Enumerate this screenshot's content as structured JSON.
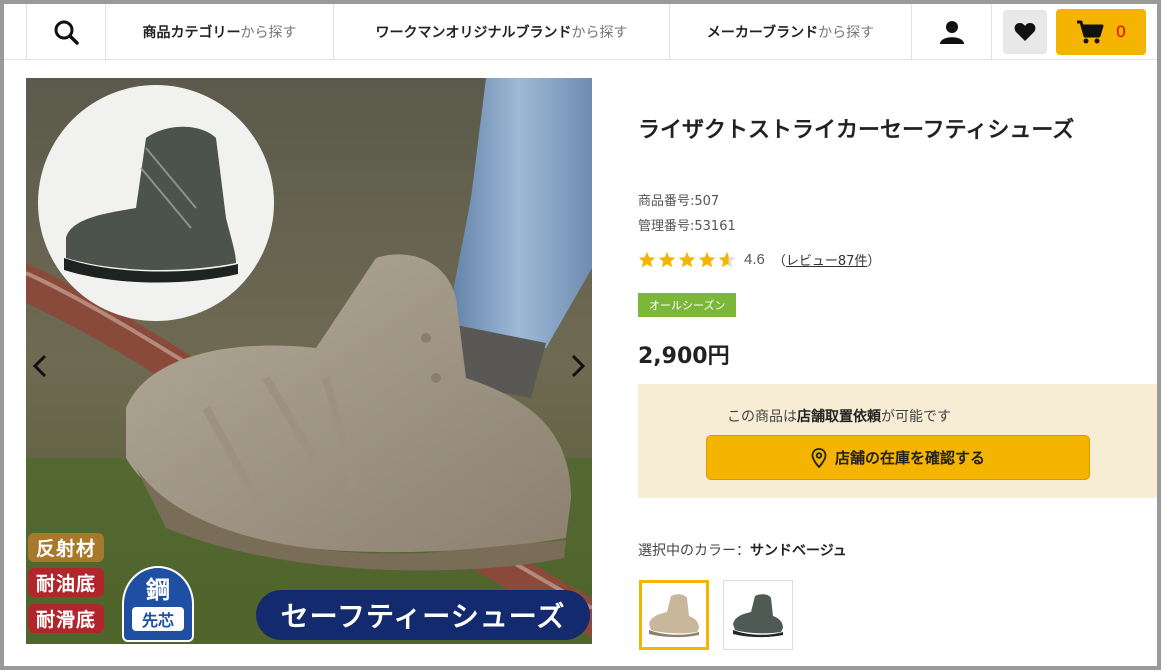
{
  "header": {
    "nav": [
      {
        "bold": "商品カテゴリー",
        "suffix": "から探す"
      },
      {
        "bold": "ワークマンオリジナルブランド",
        "suffix": "から探す"
      },
      {
        "bold": "メーカーブランド",
        "suffix": "から探す"
      }
    ],
    "cart_count": "0",
    "accent_color": "#f5b400"
  },
  "gallery": {
    "badges": [
      "反射材",
      "耐油底",
      "耐滑底"
    ],
    "steel_badge": {
      "top": "鋼",
      "bottom": "先芯"
    },
    "banner": "セーフティーシューズ"
  },
  "product": {
    "title": "ライザクトストライカーセーフティシューズ",
    "item_number": "商品番号:507",
    "manage_number": "管理番号:53161",
    "rating": 4.6,
    "rating_text": "4.6",
    "review_open": "（",
    "review_link": "レビュー87件",
    "review_close": "）",
    "season_tag": "オールシーズン",
    "price": "2,900円"
  },
  "store": {
    "text_prefix": "この商品は",
    "text_bold": "店舗取置依頼",
    "text_suffix": "が可能です",
    "button_label": "店舗の在庫を確認する"
  },
  "colors": {
    "label": "選択中のカラー：",
    "selected": "サンドベージュ",
    "swatches": [
      "sand-beige",
      "khaki"
    ]
  }
}
